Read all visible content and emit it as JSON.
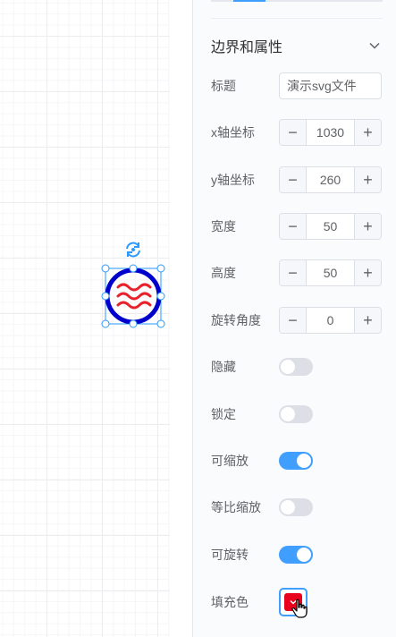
{
  "canvas": {
    "shape": {
      "name": "演示svg文件",
      "ring_color": "#0000cc",
      "wave_color": "#e8222a",
      "selection_color": "#2b9aff"
    }
  },
  "panel": {
    "section_title": "边界和属性",
    "title_label": "标题",
    "title_value": "演示svg文件",
    "x_label": "x轴坐标",
    "x_value": "1030",
    "y_label": "y轴坐标",
    "y_value": "260",
    "width_label": "宽度",
    "width_value": "50",
    "height_label": "高度",
    "height_value": "50",
    "rotation_label": "旋转角度",
    "rotation_value": "0",
    "hidden_label": "隐藏",
    "hidden_on": false,
    "locked_label": "锁定",
    "locked_on": false,
    "scalable_label": "可缩放",
    "scalable_on": true,
    "proportional_label": "等比缩放",
    "proportional_on": false,
    "rotatable_label": "可旋转",
    "rotatable_on": true,
    "fill_label": "填充色",
    "fill_color": "#e8001c",
    "minus_symbol": "−",
    "plus_symbol": "+"
  }
}
